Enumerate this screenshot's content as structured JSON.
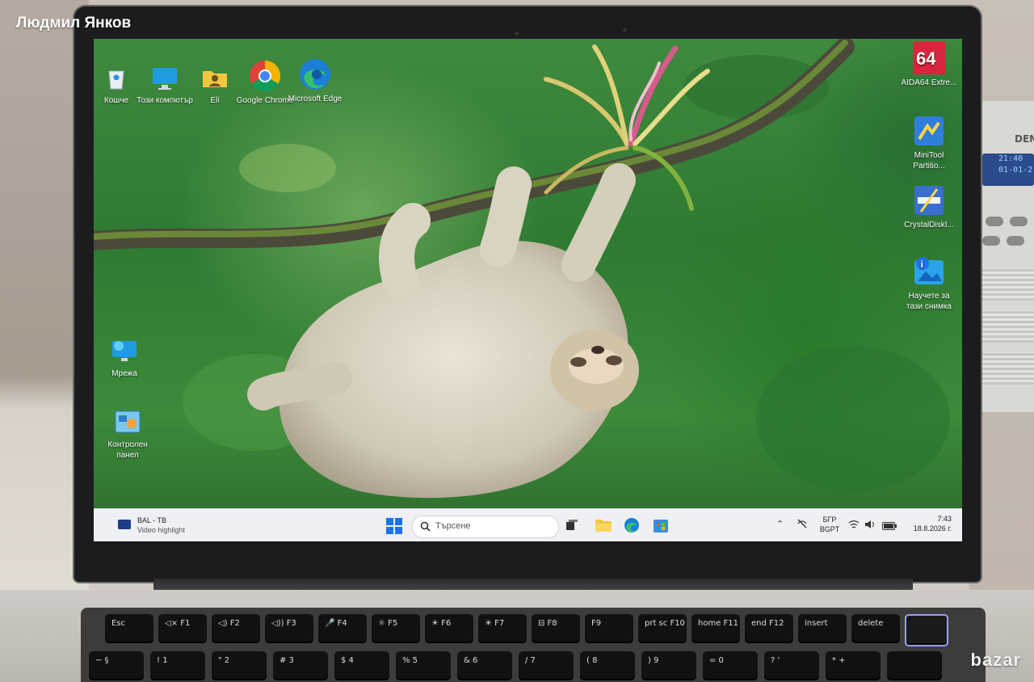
{
  "watermark": {
    "author": "Людмил Янков",
    "logo": "bazar"
  },
  "radio": {
    "brand": "DEN",
    "lcd_line1": "21:40",
    "lcd_line2": "01-01-2"
  },
  "desktop_icons_left": [
    {
      "label": "Кошче",
      "icon": "recycle-bin-icon"
    },
    {
      "label": "Този компютър",
      "icon": "computer-icon"
    },
    {
      "label": "Eli",
      "icon": "user-folder-icon"
    },
    {
      "label": "Google Chrome",
      "icon": "chrome-icon"
    },
    {
      "label": "Microsoft Edge",
      "icon": "edge-icon"
    },
    {
      "label": "Мрежа",
      "icon": "network-icon"
    },
    {
      "label": "Контролен панел",
      "icon": "control-panel-icon"
    }
  ],
  "desktop_icons_right": [
    {
      "label": "AIDA64 Extre...",
      "icon": "aida64-icon"
    },
    {
      "label": "MiniTool Partitio...",
      "icon": "minitool-icon"
    },
    {
      "label": "CrystalDiskI...",
      "icon": "crystaldisk-icon"
    },
    {
      "label": "Научете за тази снимка",
      "icon": "learn-about-picture-icon"
    }
  ],
  "taskbar": {
    "widget_title": "BAL - TB",
    "widget_subtitle": "Video highlight",
    "search_placeholder": "Търсене",
    "language_top": "БГР",
    "language_bottom": "BGPT",
    "time": "7:43",
    "date": "18.8.2026 г."
  },
  "keyboard": {
    "row1": [
      "Esc",
      "◁×  F1",
      "◁)  F2",
      "◁))  F3",
      "🎤  F4",
      "☼  F5",
      "☀  F6",
      "☀  F7",
      "⊟  F8",
      "F9",
      "prt sc  F10",
      "home  F11",
      "end  F12",
      "insert",
      "delete",
      ""
    ],
    "row2": [
      "~  §",
      "!  1",
      "\"  2",
      "#  3",
      "$  4",
      "%  5",
      "&  6",
      "/  7",
      "(  8",
      ")  9",
      "=  0",
      "?  '",
      "*  +",
      ""
    ]
  }
}
